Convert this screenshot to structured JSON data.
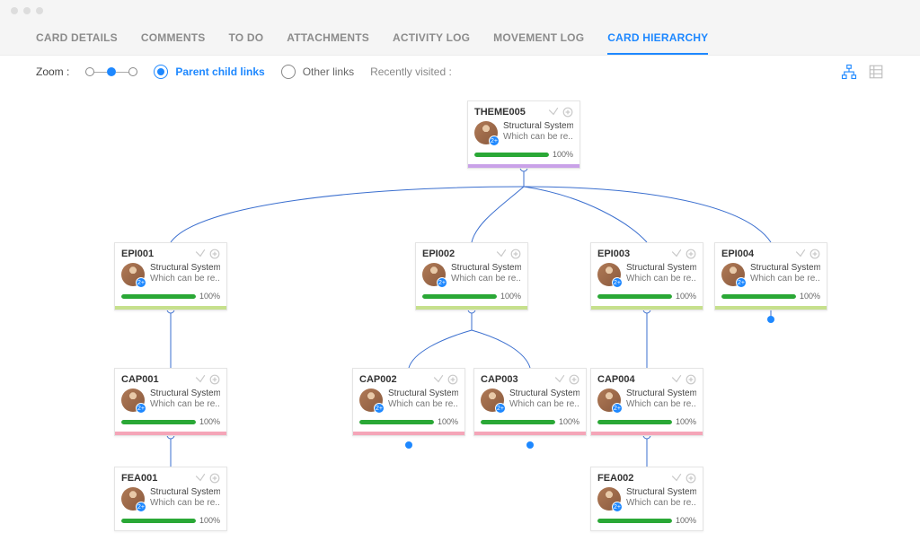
{
  "tabs": {
    "card_details": "CARD DETAILS",
    "comments": "COMMENTS",
    "todo": "TO DO",
    "attachments": "ATTACHMENTS",
    "activity_log": "ACTIVITY LOG",
    "movement_log": "MOVEMENT LOG",
    "card_hierarchy": "CARD HIERARCHY"
  },
  "controls": {
    "zoom_label": "Zoom :",
    "parent_child_links": "Parent child links",
    "other_links": "Other  links",
    "recently_visited": "Recently visited :"
  },
  "cards": {
    "theme005": {
      "id": "THEME005",
      "title": "Structural System",
      "sub": "Which can be re...",
      "progress": "100%",
      "pct": 100,
      "accent": "accent-purple",
      "badge": "2+"
    },
    "epi001": {
      "id": "EPI001",
      "title": "Structural System",
      "sub": "Which can be re...",
      "progress": "100%",
      "pct": 100,
      "accent": "accent-lime",
      "badge": "2+"
    },
    "epi002": {
      "id": "EPI002",
      "title": "Structural System",
      "sub": "Which can be re...",
      "progress": "100%",
      "pct": 100,
      "accent": "accent-lime",
      "badge": "2+"
    },
    "epi003": {
      "id": "EPI003",
      "title": "Structural System",
      "sub": "Which can be re...",
      "progress": "100%",
      "pct": 100,
      "accent": "accent-lime",
      "badge": "2+"
    },
    "epi004": {
      "id": "EPI004",
      "title": "Structural System",
      "sub": "Which can be re...",
      "progress": "100%",
      "pct": 100,
      "accent": "accent-lime",
      "badge": "2+"
    },
    "cap001": {
      "id": "CAP001",
      "title": "Structural System",
      "sub": "Which can be re...",
      "progress": "100%",
      "pct": 100,
      "accent": "accent-pink",
      "badge": "2+"
    },
    "cap002": {
      "id": "CAP002",
      "title": "Structural System",
      "sub": "Which can be re...",
      "progress": "100%",
      "pct": 100,
      "accent": "accent-pink",
      "badge": "2+"
    },
    "cap003": {
      "id": "CAP003",
      "title": "Structural System",
      "sub": "Which can be re...",
      "progress": "100%",
      "pct": 100,
      "accent": "accent-pink",
      "badge": "2+"
    },
    "cap004": {
      "id": "CAP004",
      "title": "Structural System",
      "sub": "Which can be re...",
      "progress": "100%",
      "pct": 100,
      "accent": "accent-pink",
      "badge": "2+"
    },
    "fea001": {
      "id": "FEA001",
      "title": "Structural System",
      "sub": "Which can be re...",
      "progress": "100%",
      "pct": 100,
      "accent": "",
      "badge": "2+"
    },
    "fea002": {
      "id": "FEA002",
      "title": "Structural System",
      "sub": "Which can be re...",
      "progress": "100%",
      "pct": 100,
      "accent": "",
      "badge": "2+"
    }
  },
  "colors": {
    "connector": "#3b6fcf"
  }
}
